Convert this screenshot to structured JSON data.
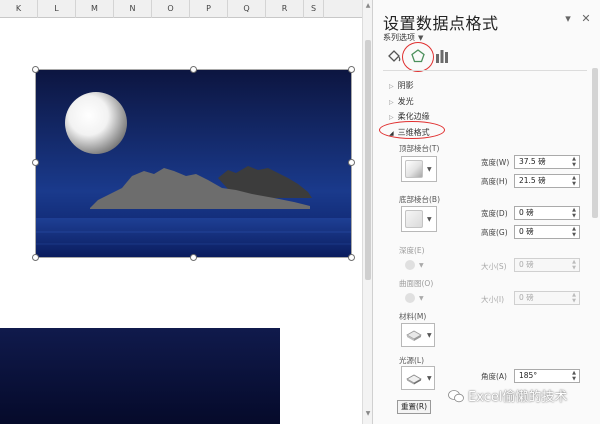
{
  "sheet": {
    "columns": [
      "K",
      "L",
      "M",
      "N",
      "O",
      "P",
      "Q",
      "R",
      "S"
    ]
  },
  "pane": {
    "title": "设置数据点格式",
    "series_options": "系列选项",
    "sections": {
      "shadow": "阴影",
      "glow": "发光",
      "soft_edges": "柔化边缘",
      "three_d": "三维格式"
    },
    "top_bevel": "顶部棱台(T)",
    "bottom_bevel": "底部棱台(B)",
    "depth": "深度(E)",
    "contour": "曲面图(O)",
    "material": "材料(M)",
    "lighting": "光源(L)",
    "width_label": "宽度(W)",
    "height_label": "高度(H)",
    "width_label_b": "宽度(D)",
    "height_label_b": "高度(G)",
    "size_label": "大小(S)",
    "size_label_c": "大小(I)",
    "angle_label": "角度(A)",
    "top_width": "37.5 磅",
    "top_height": "21.5 磅",
    "bottom_width": "0 磅",
    "bottom_height": "0 磅",
    "depth_size": "0 磅",
    "contour_size": "0 磅",
    "angle": "185°",
    "reset": "重置(R)"
  },
  "watermark": "Excel偷懒的技术",
  "colors": {
    "accent_green": "#2e7d32",
    "highlight_red": "#e03030",
    "night_sky_top": "#0c1540",
    "night_sky_bottom": "#1a3a8c"
  },
  "icons": {
    "fill_tab": "paint-bucket-icon",
    "effects_tab": "pentagon-icon",
    "series_tab": "bar-chart-icon",
    "close": "close-icon",
    "dropdown": "chevron-down-icon"
  }
}
